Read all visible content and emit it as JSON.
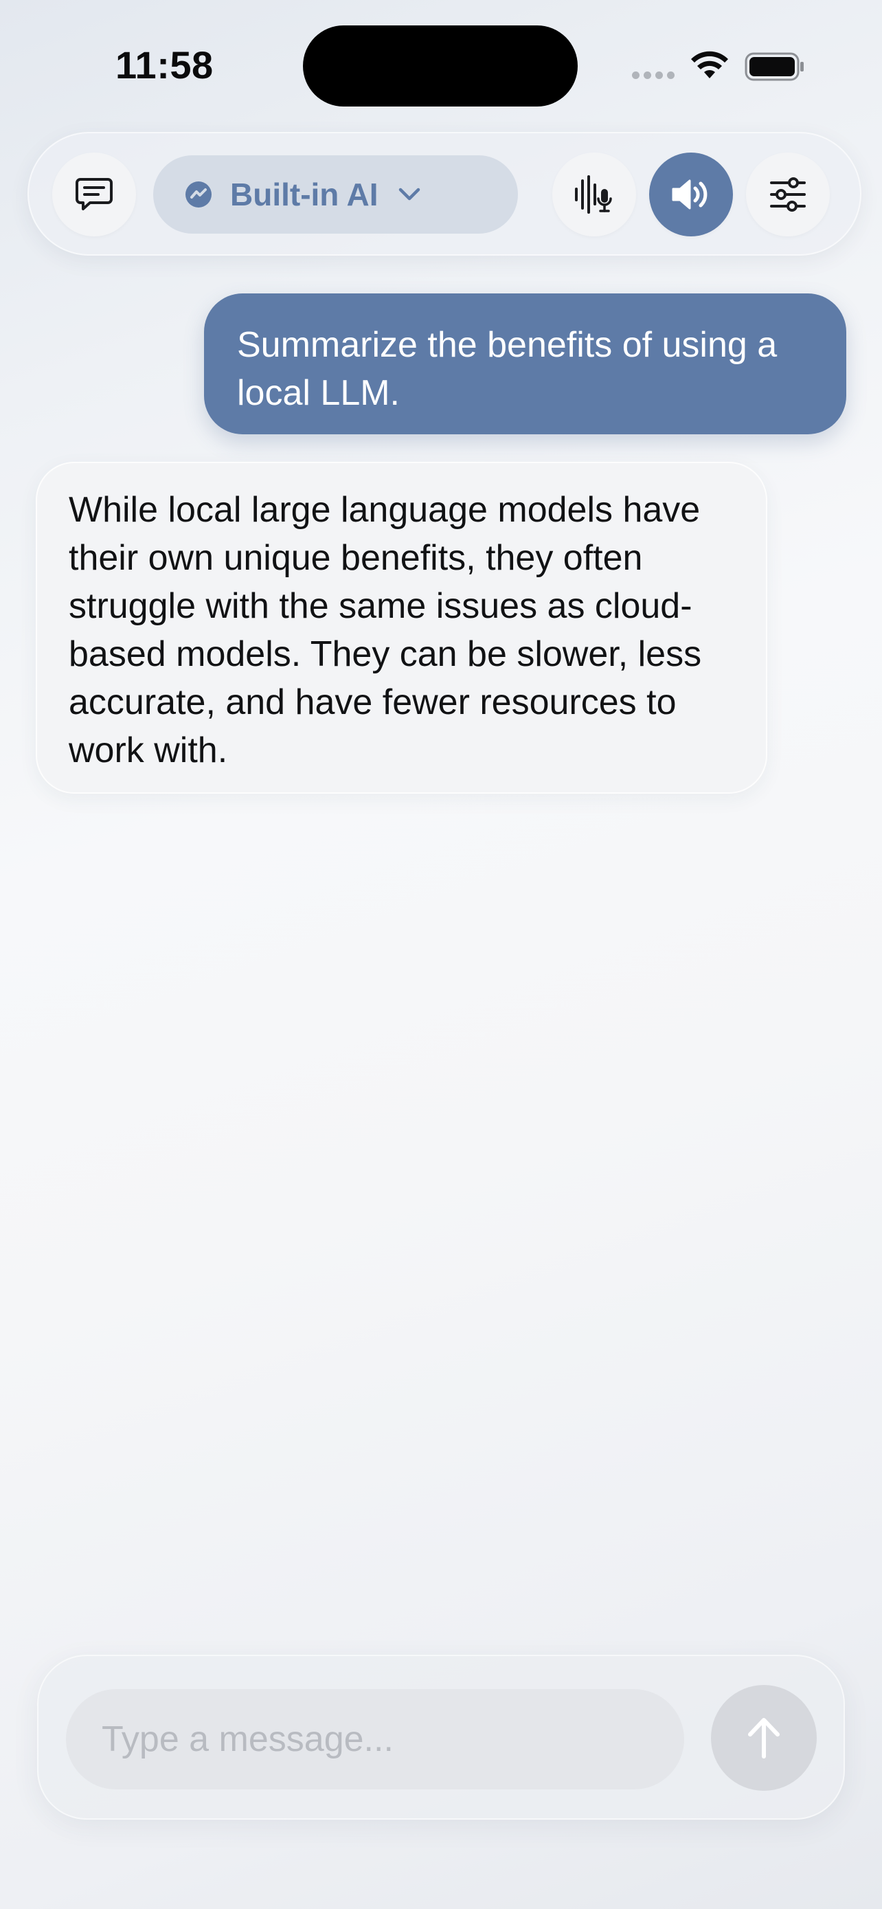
{
  "status_bar": {
    "time": "11:58"
  },
  "toolbar": {
    "model_selector_label": "Built-in AI",
    "icons": {
      "chat": "chat-bubble-icon",
      "model": "model-logo-icon",
      "dropdown": "chevron-down-icon",
      "voice": "voice-waveform-mic-icon",
      "speaker": "speaker-icon",
      "settings": "sliders-icon"
    }
  },
  "messages": [
    {
      "role": "user",
      "text": "Summarize the benefits of using a local LLM."
    },
    {
      "role": "assistant",
      "text": "While local large language models have their own unique benefits, they often struggle with the same issues as cloud-based models. They can be slower, less accurate, and have fewer resources to work with."
    }
  ],
  "composer": {
    "placeholder": "Type a message...",
    "send_icon": "arrow-up-icon"
  },
  "colors": {
    "accent": "#5e7ba7",
    "user_bubble": "#5e7ba7",
    "assistant_bubble": "#f3f4f6",
    "model_pill": "#d5dce6"
  }
}
